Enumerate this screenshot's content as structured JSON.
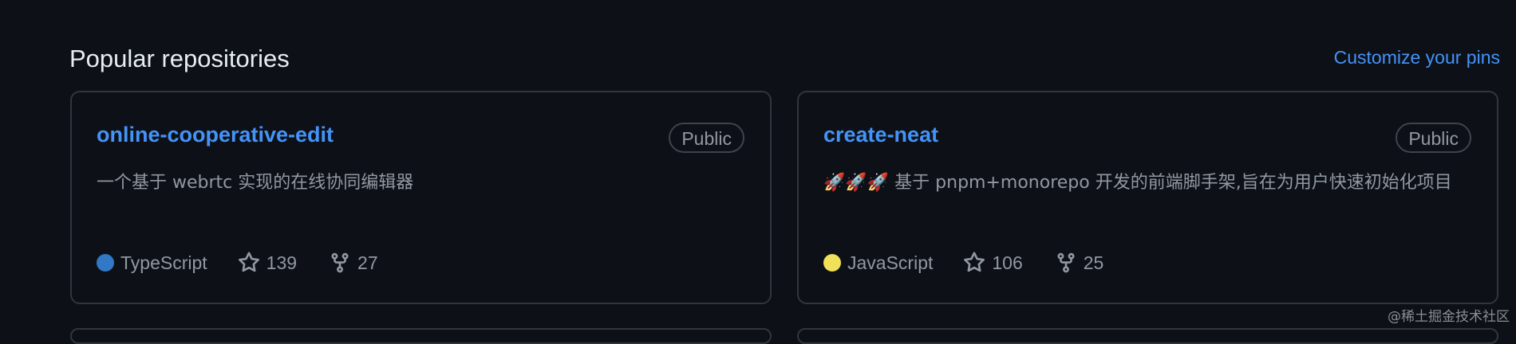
{
  "section": {
    "title": "Popular repositories",
    "customize_label": "Customize your pins"
  },
  "repos": [
    {
      "name": "online-cooperative-edit",
      "visibility": "Public",
      "description": "一个基于 webrtc 实现的在线协同编辑器",
      "language": "TypeScript",
      "language_color": "#3178c6",
      "stars": "139",
      "forks": "27"
    },
    {
      "name": "create-neat",
      "visibility": "Public",
      "description": "🚀🚀🚀 基于 pnpm+monorepo 开发的前端脚手架,旨在为用户快速初始化项目",
      "language": "JavaScript",
      "language_color": "#f1e05a",
      "stars": "106",
      "forks": "25"
    }
  ],
  "icons": {
    "star": "star-icon",
    "fork": "repo-forked-icon"
  },
  "colors": {
    "link": "#4493f8",
    "background": "#0d1117",
    "border": "#30363d",
    "muted_text": "#9198a1"
  },
  "watermark": "@稀土掘金技术社区"
}
